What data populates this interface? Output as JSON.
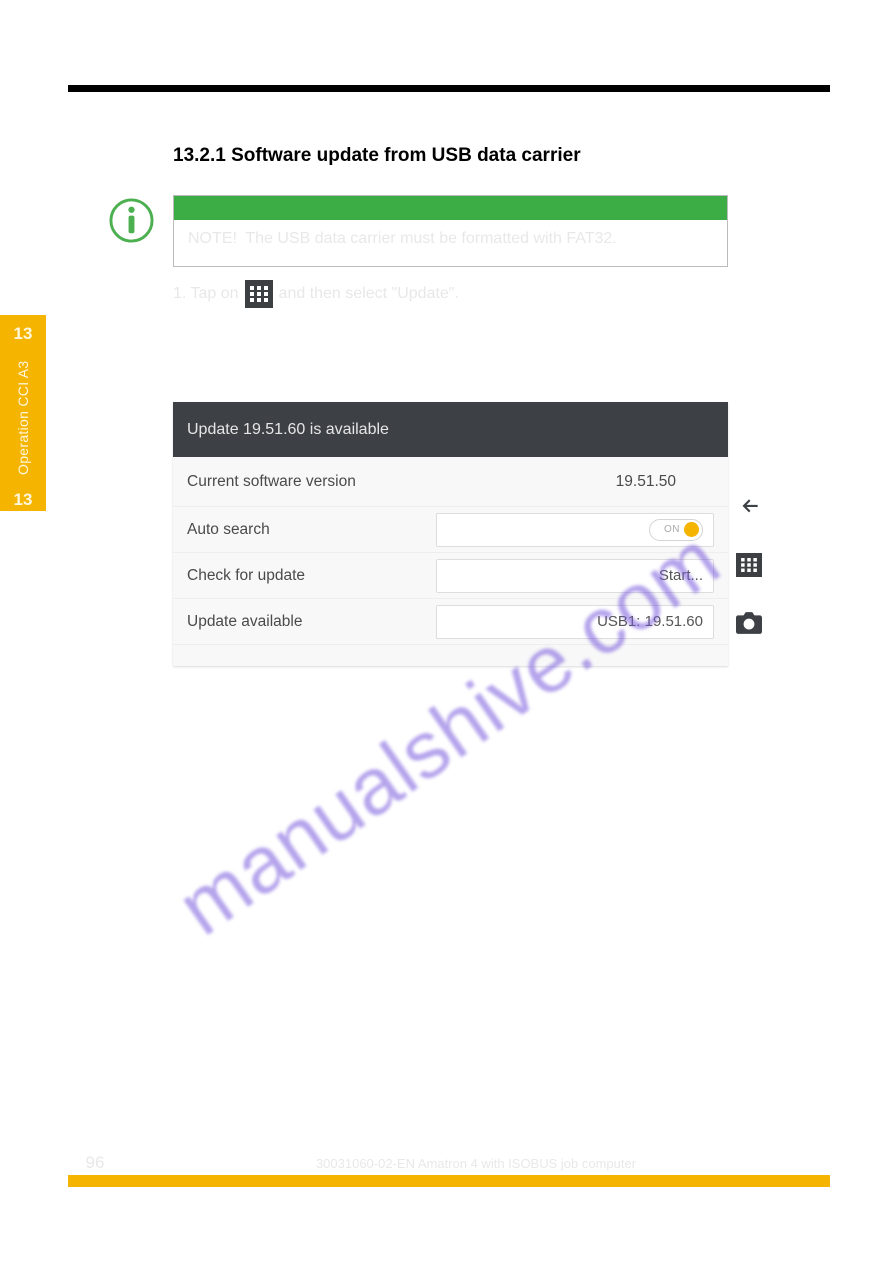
{
  "heading": "13.2.1 Software update from USB data carrier",
  "note": {
    "label": "NOTE!",
    "text": "The USB data carrier must be formatted with FAT32."
  },
  "step_one": {
    "prefix": "1. Tap on",
    "rest": "and then select \"Update\"."
  },
  "screenshot": {
    "header": "Update 19.51.60 is available",
    "rows": {
      "version_label": "Current software version",
      "version_value": "19.51.50",
      "auto_label": "Auto search",
      "toggle_state": "ON",
      "check_label": "Check for update",
      "check_value": "Start...",
      "avail_label": "Update available",
      "avail_value": "USB1: 19.51.60"
    }
  },
  "watermark": "manualshive.com",
  "sidetab": {
    "top_num": "13",
    "label": "Operation CCI A3",
    "bottom_num": "13"
  },
  "footer": {
    "page": "96",
    "text": "30031060-02-EN Amatron 4 with ISOBUS job computer"
  }
}
